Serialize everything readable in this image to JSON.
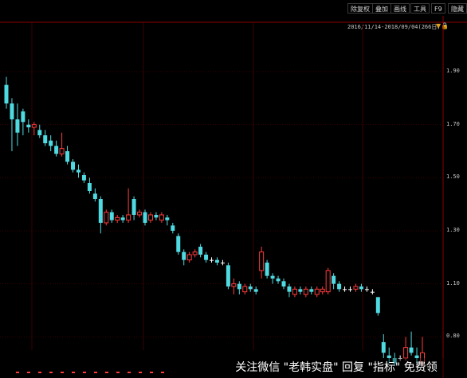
{
  "toolbar": {
    "buttons": [
      "除复权",
      "叠加",
      "画线",
      "工具",
      "F9",
      "隐藏"
    ]
  },
  "date_range": "2016/11/14-2018/09/04(266日)",
  "overlay_text": "关注微信 \"老韩实盘\" 回复 \"指标\" 免费领",
  "colors": {
    "up": "#ff3b3b",
    "down": "#4fd9e0",
    "grid": "#3a0000",
    "axis": "#8b0000"
  },
  "chart_data": {
    "type": "candlestick",
    "y_ticks": [
      "1.90",
      "1.70",
      "1.50",
      "1.30",
      "1.10",
      "0.80"
    ],
    "y_tick_values": [
      1.9,
      1.7,
      1.5,
      1.3,
      1.1,
      0.9
    ],
    "ylim": [
      0.85,
      2.05
    ],
    "candles": [
      [
        1.85,
        1.78,
        1.88,
        1.76
      ],
      [
        1.78,
        1.72,
        1.8,
        1.6
      ],
      [
        1.72,
        1.67,
        1.78,
        1.62
      ],
      [
        1.75,
        1.71,
        1.76,
        1.66
      ],
      [
        1.7,
        1.69,
        1.72,
        1.67
      ],
      [
        1.69,
        1.7,
        1.71,
        1.66
      ],
      [
        1.68,
        1.66,
        1.7,
        1.65
      ],
      [
        1.66,
        1.63,
        1.68,
        1.62
      ],
      [
        1.64,
        1.62,
        1.66,
        1.6
      ],
      [
        1.62,
        1.59,
        1.64,
        1.58
      ],
      [
        1.59,
        1.61,
        1.67,
        1.58
      ],
      [
        1.6,
        1.56,
        1.62,
        1.55
      ],
      [
        1.56,
        1.53,
        1.57,
        1.52
      ],
      [
        1.53,
        1.52,
        1.55,
        1.5
      ],
      [
        1.51,
        1.49,
        1.52,
        1.48
      ],
      [
        1.48,
        1.45,
        1.5,
        1.44
      ],
      [
        1.44,
        1.42,
        1.46,
        1.41
      ],
      [
        1.42,
        1.33,
        1.43,
        1.29
      ],
      [
        1.33,
        1.37,
        1.38,
        1.32
      ],
      [
        1.37,
        1.34,
        1.38,
        1.33
      ],
      [
        1.34,
        1.35,
        1.36,
        1.33
      ],
      [
        1.35,
        1.34,
        1.36,
        1.33
      ],
      [
        1.34,
        1.36,
        1.46,
        1.33
      ],
      [
        1.42,
        1.36,
        1.43,
        1.34
      ],
      [
        1.36,
        1.37,
        1.38,
        1.35
      ],
      [
        1.37,
        1.33,
        1.38,
        1.32
      ],
      [
        1.34,
        1.36,
        1.37,
        1.33
      ],
      [
        1.36,
        1.35,
        1.37,
        1.34
      ],
      [
        1.34,
        1.36,
        1.37,
        1.33
      ],
      [
        1.35,
        1.34,
        1.36,
        1.32
      ],
      [
        1.32,
        1.3,
        1.33,
        1.29
      ],
      [
        1.28,
        1.22,
        1.29,
        1.21
      ],
      [
        1.22,
        1.19,
        1.23,
        1.17
      ],
      [
        1.19,
        1.21,
        1.22,
        1.18
      ],
      [
        1.21,
        1.22,
        1.23,
        1.2
      ],
      [
        1.24,
        1.21,
        1.25,
        1.2
      ],
      [
        1.21,
        1.19,
        1.22,
        1.18
      ],
      [
        1.19,
        1.19,
        1.2,
        1.18
      ],
      [
        1.19,
        1.18,
        1.2,
        1.17
      ],
      [
        1.18,
        1.18,
        1.19,
        1.17
      ],
      [
        1.17,
        1.09,
        1.18,
        1.08
      ],
      [
        1.09,
        1.1,
        1.12,
        1.06
      ],
      [
        1.1,
        1.08,
        1.11,
        1.06
      ],
      [
        1.07,
        1.09,
        1.1,
        1.06
      ],
      [
        1.09,
        1.08,
        1.1,
        1.07
      ],
      [
        1.08,
        1.07,
        1.09,
        1.06
      ],
      [
        1.15,
        1.22,
        1.24,
        1.12
      ],
      [
        1.18,
        1.13,
        1.19,
        1.12
      ],
      [
        1.13,
        1.12,
        1.14,
        1.1
      ],
      [
        1.12,
        1.11,
        1.13,
        1.1
      ],
      [
        1.11,
        1.09,
        1.12,
        1.08
      ],
      [
        1.09,
        1.07,
        1.1,
        1.05
      ],
      [
        1.06,
        1.08,
        1.09,
        1.05
      ],
      [
        1.08,
        1.07,
        1.09,
        1.06
      ],
      [
        1.06,
        1.08,
        1.09,
        1.05
      ],
      [
        1.08,
        1.07,
        1.09,
        1.06
      ],
      [
        1.06,
        1.08,
        1.09,
        1.05
      ],
      [
        1.07,
        1.08,
        1.09,
        1.06
      ],
      [
        1.07,
        1.15,
        1.16,
        1.06
      ],
      [
        1.13,
        1.1,
        1.14,
        1.08
      ],
      [
        1.1,
        1.08,
        1.11,
        1.07
      ],
      [
        1.08,
        1.08,
        1.09,
        1.07
      ],
      [
        1.08,
        1.08,
        1.09,
        1.07
      ],
      [
        1.08,
        1.09,
        1.1,
        1.07
      ],
      [
        1.09,
        1.08,
        1.1,
        1.07
      ],
      [
        1.08,
        1.08,
        1.09,
        1.07
      ],
      [
        1.07,
        1.07,
        1.08,
        1.06
      ],
      [
        1.05,
        0.99,
        1.05,
        0.98
      ],
      [
        0.88,
        0.84,
        0.91,
        0.82
      ],
      [
        0.83,
        0.82,
        0.86,
        0.8
      ],
      [
        0.82,
        0.8,
        0.84,
        0.79
      ],
      [
        0.82,
        0.82,
        0.83,
        0.81
      ],
      [
        0.82,
        0.86,
        0.9,
        0.81
      ],
      [
        0.86,
        0.84,
        0.92,
        0.83
      ],
      [
        0.83,
        0.82,
        0.86,
        0.8
      ],
      [
        0.8,
        0.84,
        0.9,
        0.79
      ]
    ]
  }
}
